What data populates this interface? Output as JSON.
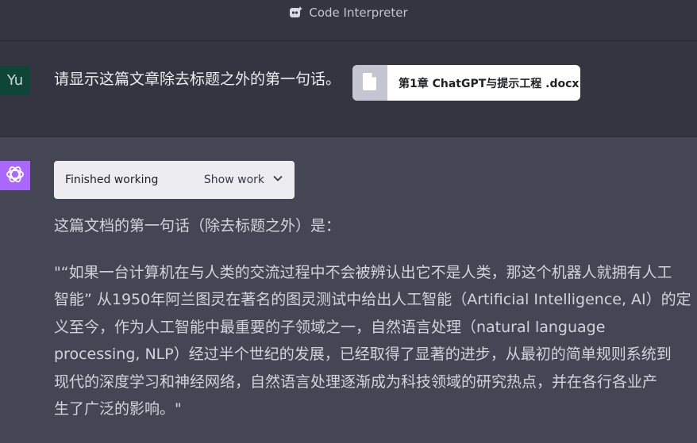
{
  "header": {
    "model_name": "Code Interpreter",
    "model_icon": "plugin-icon"
  },
  "user_message": {
    "avatar_initials": "Yu",
    "avatar_color": "#0e4537",
    "text": "请显示这篇文章除去标题之外的第一句话。",
    "attachment": {
      "icon": "document-icon",
      "file_name": "第1章 ChatGPT与提示工程 .docx"
    }
  },
  "assistant_message": {
    "avatar_icon": "openai-logo-icon",
    "avatar_color": "#ab68ff",
    "work_status": "Finished working",
    "show_work_label": "Show work",
    "intro": "这篇文档的第一句话（除去标题之外）是：",
    "quote_lines": [
      "\"“如果一台计算机在与人类的交流过程中不会被辨认出它不是人类，那这个机器人就拥有人工",
      "智能” 从1950年阿兰图灵在著名的图灵测试中给出人工智能（Artificial Intelligence, AI）的定",
      "义至今，作为人工智能中最重要的子领域之一，自然语言处理（natural language",
      "processing, NLP）经过半个世纪的发展，已经取得了显著的进步，从最初的简单规则系统到",
      "现代的深度学习和神经网络，自然语言处理逐渐成为科技领域的研究热点，并在各行各业产",
      "生了广泛的影响。\""
    ]
  },
  "colors": {
    "page_background": "#343541",
    "assistant_background": "#444654",
    "text": "#d1d5db"
  }
}
